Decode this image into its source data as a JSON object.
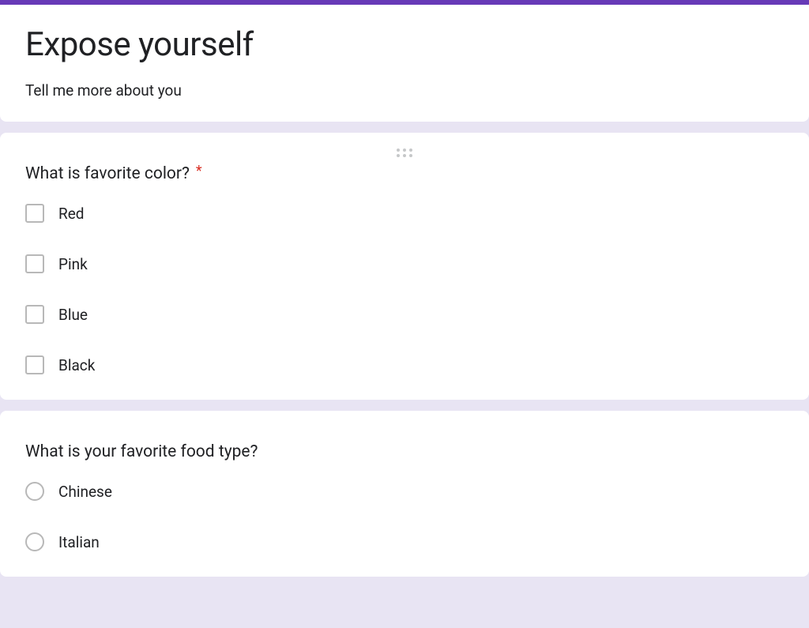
{
  "colors": {
    "accent": "#673ab7",
    "required": "#d93025",
    "background": "#e8e4f3"
  },
  "header": {
    "title": "Expose yourself",
    "description": "Tell me more about you"
  },
  "questions": [
    {
      "title": "What is favorite color?",
      "required": true,
      "type": "checkbox",
      "showDragHandle": true,
      "options": [
        "Red",
        "Pink",
        "Blue",
        "Black"
      ]
    },
    {
      "title": "What is your favorite food type?",
      "required": false,
      "type": "radio",
      "showDragHandle": false,
      "options": [
        "Chinese",
        "Italian"
      ]
    }
  ]
}
